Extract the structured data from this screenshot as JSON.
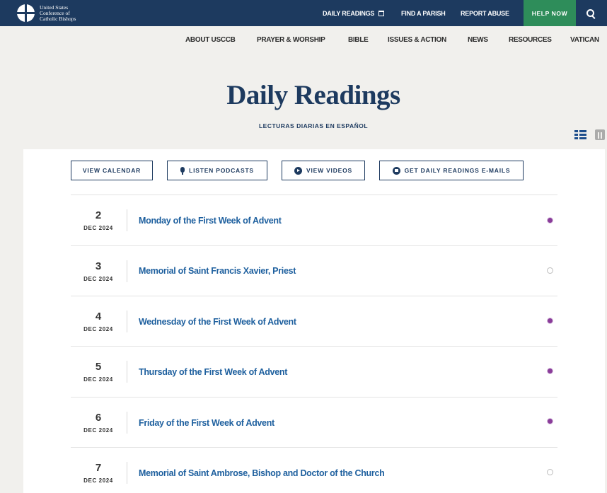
{
  "header": {
    "logo_text": [
      "United States",
      "Conference of",
      "Catholic Bishops"
    ],
    "utility_links": [
      {
        "label": "DAILY READINGS",
        "icon": "calendar-icon"
      },
      {
        "label": "FIND A PARISH"
      },
      {
        "label": "REPORT ABUSE"
      }
    ],
    "help_label": "HELP NOW",
    "search_icon": "search-icon",
    "colors": {
      "bar": "#1d3a5f",
      "help": "#2e8d5a"
    }
  },
  "main_nav": [
    "ABOUT USCCB",
    "PRAYER & WORSHIP",
    "BIBLE",
    "ISSUES & ACTION",
    "NEWS",
    "RESOURCES",
    "VATICAN"
  ],
  "hero": {
    "title": "Daily Readings",
    "spanish_link": "LECTURAS DIARIAS EN ESPAÑOL",
    "view_icons": [
      "list-view-icon",
      "calendar-view-icon"
    ]
  },
  "actions": [
    {
      "label": "VIEW CALENDAR",
      "icon": null
    },
    {
      "label": "LISTEN PODCASTS",
      "icon": "microphone-icon"
    },
    {
      "label": "VIEW VIDEOS",
      "icon": "play-icon"
    },
    {
      "label": "GET DAILY READINGS E-MAILS",
      "icon": "mail-icon"
    }
  ],
  "readings": [
    {
      "day": "2",
      "month": "DEC 2024",
      "title": "Monday of the First Week of Advent",
      "color": "violet"
    },
    {
      "day": "3",
      "month": "DEC 2024",
      "title": "Memorial of Saint Francis Xavier, Priest",
      "color": "white"
    },
    {
      "day": "4",
      "month": "DEC 2024",
      "title": "Wednesday of the First Week of Advent",
      "color": "violet"
    },
    {
      "day": "5",
      "month": "DEC 2024",
      "title": "Thursday of the First Week of Advent",
      "color": "violet"
    },
    {
      "day": "6",
      "month": "DEC 2024",
      "title": "Friday of the First Week of Advent",
      "color": "violet"
    },
    {
      "day": "7",
      "month": "DEC 2024",
      "title": "Memorial of Saint Ambrose, Bishop and Doctor of the Church",
      "color": "white"
    }
  ]
}
